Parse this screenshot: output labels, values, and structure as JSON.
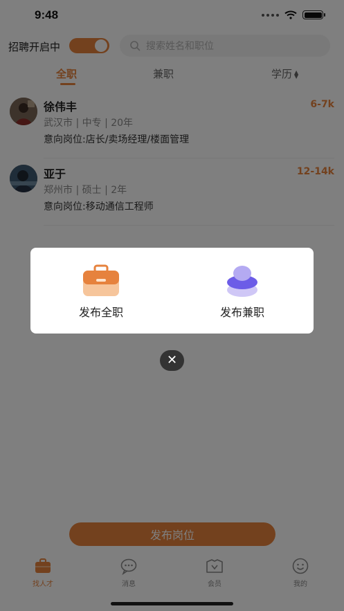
{
  "status_bar": {
    "time": "9:48"
  },
  "header": {
    "recruit_label": "招聘开启中",
    "recruit_toggle_on": true,
    "search_placeholder": "搜索姓名和职位"
  },
  "tabs": [
    {
      "label": "全职",
      "active": true
    },
    {
      "label": "兼职",
      "active": false
    },
    {
      "label": "学历",
      "active": false,
      "sortable": true
    }
  ],
  "candidates": [
    {
      "name": "徐伟丰",
      "salary": "6-7k",
      "meta": "武汉市 | 中专 | 20年",
      "intent": "意向岗位:店长/卖场经理/楼面管理"
    },
    {
      "name": "亚于",
      "salary": "12-14k",
      "meta": "郑州市 | 硕士 | 2年",
      "intent": "意向岗位:移动通信工程师"
    }
  ],
  "publish_button_label": "发布岗位",
  "tabbar": [
    {
      "label": "找人才",
      "icon": "briefcase-icon",
      "active": true
    },
    {
      "label": "消息",
      "icon": "chat-icon",
      "active": false
    },
    {
      "label": "会员",
      "icon": "membership-icon",
      "active": false
    },
    {
      "label": "我的",
      "icon": "smiley-icon",
      "active": false
    }
  ],
  "dialog": {
    "fulltime_label": "发布全职",
    "parttime_label": "发布兼职",
    "fulltime_icon": "briefcase-icon",
    "parttime_icon": "stack-icon",
    "close_icon": "close-icon"
  },
  "colors": {
    "accent": "#e6823d",
    "parttime_icon": "#6c5ce7"
  }
}
